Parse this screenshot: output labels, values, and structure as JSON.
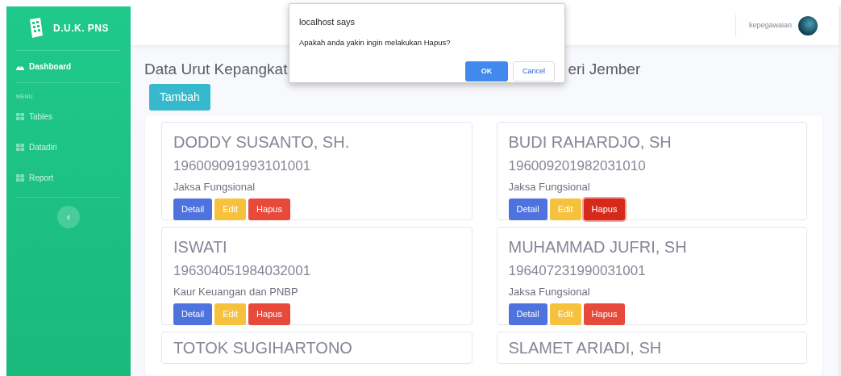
{
  "brand": {
    "name": "D.U.K. PNS"
  },
  "sidebar": {
    "items": [
      {
        "kind": "link",
        "label": "Dashboard",
        "selected": true
      },
      {
        "kind": "heading",
        "label": "MENU"
      },
      {
        "kind": "link",
        "label": "Tables",
        "selected": false
      },
      {
        "kind": "link",
        "label": "Datadiri",
        "selected": false
      },
      {
        "kind": "link",
        "label": "Report",
        "selected": false
      }
    ],
    "toggle": "‹"
  },
  "topbar": {
    "user": "kepegawaian"
  },
  "heading_parts": [
    "Data Urut Kepangkat",
    "eri Jember"
  ],
  "add_button": "Tambah",
  "cards": [
    {
      "name": "DODDY SUSANTO, SH.",
      "nip": "196009091993101001",
      "position": "Jaksa Fungsional",
      "buttons": [
        {
          "kind": "detail",
          "label": "Detail",
          "focused": false
        },
        {
          "kind": "edit",
          "label": "Edit",
          "focused": false
        },
        {
          "kind": "delete",
          "label": "Hapus",
          "focused": false
        }
      ]
    },
    {
      "name": "BUDI RAHARDJO, SH",
      "nip": "196009201982031010",
      "position": "Jaksa Fungsional",
      "buttons": [
        {
          "kind": "detail",
          "label": "Detail",
          "focused": false
        },
        {
          "kind": "edit",
          "label": "Edit",
          "focused": false
        },
        {
          "kind": "delete",
          "label": "Hapus",
          "focused": true
        }
      ]
    },
    {
      "name": "ISWATI",
      "nip": "196304051984032001",
      "position": "Kaur Keuangan dan PNBP",
      "buttons": [
        {
          "kind": "detail",
          "label": "Detail",
          "focused": false
        },
        {
          "kind": "edit",
          "label": "Edit",
          "focused": false
        },
        {
          "kind": "delete",
          "label": "Hapus",
          "focused": false
        }
      ]
    },
    {
      "name": "MUHAMMAD JUFRI, SH",
      "nip": "196407231990031001",
      "position": "Jaksa Fungsional",
      "buttons": [
        {
          "kind": "detail",
          "label": "Detail",
          "focused": false
        },
        {
          "kind": "edit",
          "label": "Edit",
          "focused": false
        },
        {
          "kind": "delete",
          "label": "Hapus",
          "focused": false
        }
      ]
    },
    {
      "name": "TOTOK SUGIHARTONO"
    },
    {
      "name": "SLAMET ARIADI, SH"
    }
  ],
  "dialog": {
    "title": "localhost says",
    "message": "Apakah anda yakin ingin melakukan Hapus?",
    "ok": "OK",
    "cancel": "Cancel"
  }
}
